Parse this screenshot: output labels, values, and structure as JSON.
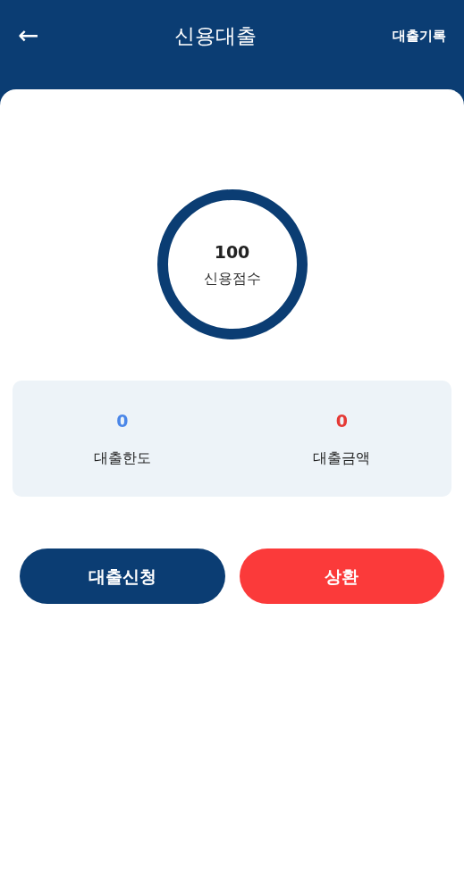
{
  "header": {
    "back": "←",
    "title": "신용대출",
    "action": "대출기록"
  },
  "score": {
    "value": "100",
    "label": "신용점수"
  },
  "stats": [
    {
      "value": "0",
      "label": "대출한도",
      "color": "#4a86e8"
    },
    {
      "value": "0",
      "label": "대출금액",
      "color": "#e53935"
    }
  ],
  "buttons": [
    {
      "label": "대출신청",
      "kind": "primary"
    },
    {
      "label": "상환",
      "kind": "danger"
    }
  ]
}
